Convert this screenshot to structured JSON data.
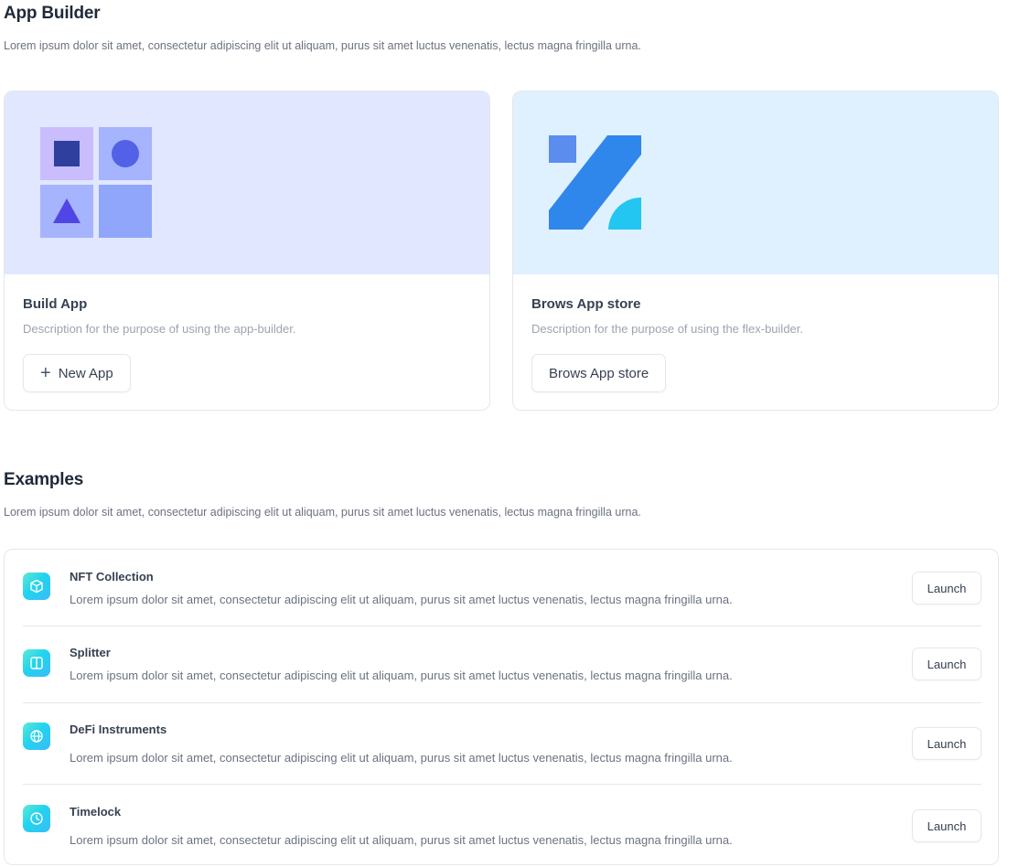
{
  "header": {
    "title": "App Builder",
    "description": "Lorem ipsum dolor sit amet, consectetur adipiscing elit ut aliquam, purus sit amet luctus venenatis, lectus magna fringilla urna."
  },
  "cards": [
    {
      "title": "Build App",
      "description": "Description for the purpose of using the app-builder.",
      "button_label": "New App",
      "button_icon": "plus-icon",
      "hero_icon": "shapes-grid-icon",
      "hero_color": "#e0e7ff"
    },
    {
      "title": "Brows App store",
      "description": "Description for the purpose of using the flex-builder.",
      "button_label": "Brows App store",
      "hero_icon": "app-store-logo-icon",
      "hero_color": "#dff0fe"
    }
  ],
  "examples": {
    "title": "Examples",
    "description": "Lorem ipsum dolor sit amet, consectetur adipiscing elit ut aliquam, purus sit amet luctus venenatis, lectus magna fringilla urna.",
    "items": [
      {
        "title": "NFT Collection",
        "description": "Lorem ipsum dolor sit amet, consectetur adipiscing elit ut aliquam, purus sit amet luctus venenatis, lectus magna fringilla urna.",
        "icon": "cube-icon",
        "button_label": "Launch"
      },
      {
        "title": "Splitter",
        "description": "Lorem ipsum dolor sit amet, consectetur adipiscing elit ut aliquam, purus sit amet luctus venenatis, lectus magna fringilla urna.",
        "icon": "split-panel-icon",
        "button_label": "Launch"
      },
      {
        "title": "DeFi Instruments",
        "description": "Lorem ipsum dolor sit amet, consectetur adipiscing elit ut aliquam, purus sit amet luctus venenatis, lectus magna fringilla urna.",
        "icon": "globe-icon",
        "button_label": "Launch"
      },
      {
        "title": "Timelock",
        "description": "Lorem ipsum dolor sit amet, consectetur adipiscing elit ut aliquam, purus sit amet luctus venenatis, lectus magna fringilla urna.",
        "icon": "clock-icon",
        "button_label": "Launch"
      }
    ]
  },
  "colors": {
    "accent": "#22d3ee",
    "text_primary": "#1f2937",
    "text_muted": "#6b7280",
    "border": "#e5e7eb"
  }
}
